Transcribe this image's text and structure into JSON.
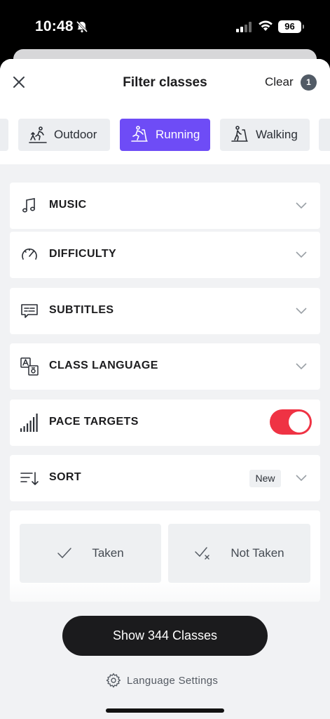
{
  "status_bar": {
    "time": "10:48",
    "battery": "96"
  },
  "header": {
    "title": "Filter classes",
    "clear_label": "Clear",
    "clear_count": "1"
  },
  "chips": [
    {
      "label": "Outdoor",
      "icon": "outdoor-runner-icon",
      "active": false
    },
    {
      "label": "Running",
      "icon": "treadmill-runner-icon",
      "active": true
    },
    {
      "label": "Walking",
      "icon": "treadmill-walker-icon",
      "active": false
    }
  ],
  "filters": {
    "music": {
      "label": "MUSIC",
      "icon": "music-note-icon"
    },
    "difficulty": {
      "label": "DIFFICULTY",
      "icon": "speedometer-icon"
    },
    "subtitles": {
      "label": "SUBTITLES",
      "icon": "subtitles-icon"
    },
    "class_language": {
      "label": "CLASS LANGUAGE",
      "icon": "language-icon"
    },
    "pace_targets": {
      "label": "PACE TARGETS",
      "icon": "signal-bars-icon",
      "enabled": true
    },
    "sort": {
      "label": "SORT",
      "icon": "sort-icon",
      "value": "New"
    }
  },
  "taken": {
    "taken_label": "Taken",
    "not_taken_label": "Not Taken"
  },
  "footer": {
    "show_button": "Show 344 Classes",
    "language_settings": "Language Settings"
  },
  "colors": {
    "accent": "#6e4cf6",
    "toggle_on": "#ef3344",
    "button_dark": "#1b1b1d"
  }
}
